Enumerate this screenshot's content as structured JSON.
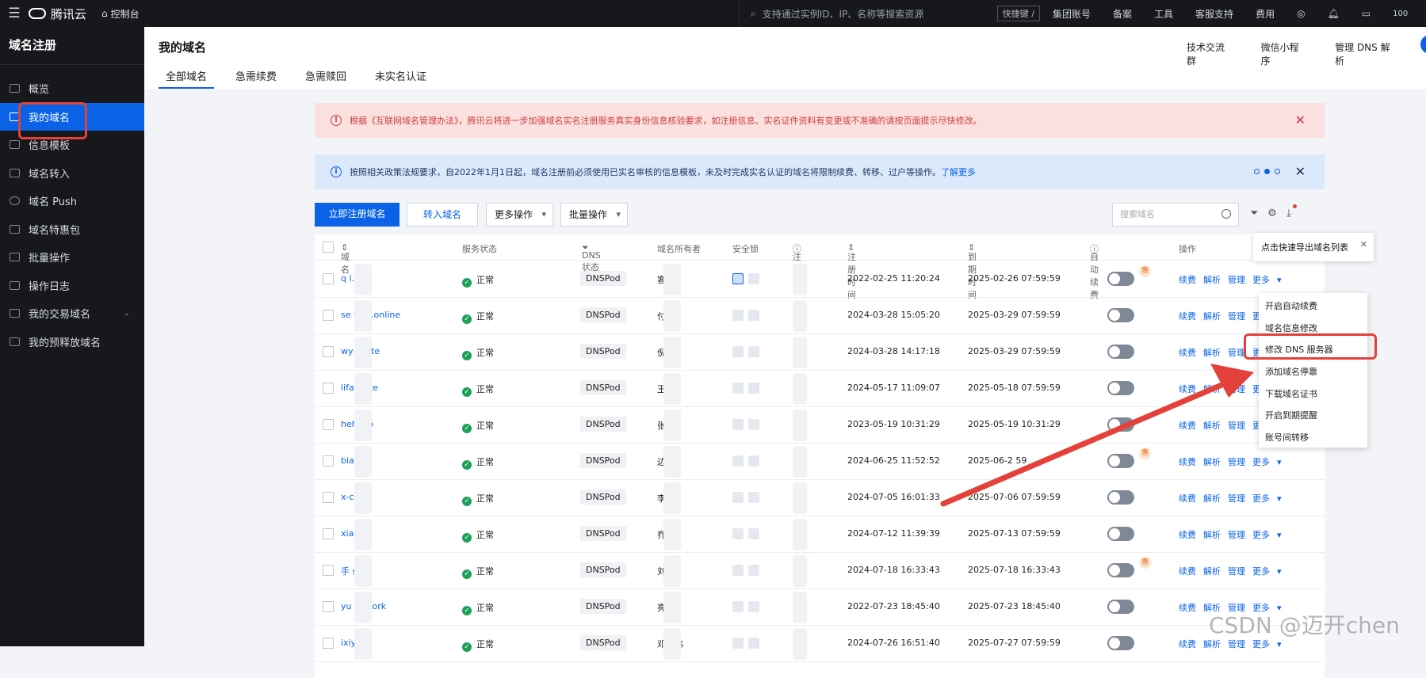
{
  "topbar": {
    "brand": "腾讯云",
    "console": "控制台",
    "search_placeholder": "支持通过实例ID、IP、名称等搜索资源",
    "shortcut": "快捷键 /",
    "links": [
      "集团账号",
      "备案",
      "工具",
      "客服支持",
      "费用"
    ],
    "corner_text": "100"
  },
  "sidebar": {
    "title": "域名注册",
    "items": [
      {
        "label": "概览",
        "icon": "overview-icon"
      },
      {
        "label": "我的域名",
        "icon": "domain-icon",
        "active": true
      },
      {
        "label": "信息模板",
        "icon": "template-icon"
      },
      {
        "label": "域名转入",
        "icon": "transfer-in-icon"
      },
      {
        "label": "域名 Push",
        "icon": "push-icon"
      },
      {
        "label": "域名特惠包",
        "icon": "package-icon"
      },
      {
        "label": "批量操作",
        "icon": "batch-icon"
      },
      {
        "label": "操作日志",
        "icon": "log-icon"
      },
      {
        "label": "我的交易域名",
        "icon": "trade-icon",
        "expandable": true
      },
      {
        "label": "我的预释放域名",
        "icon": "release-icon"
      }
    ]
  },
  "header": {
    "title": "我的域名",
    "links": [
      "技术交流群",
      "微信小程序",
      "管理 DNS 解析"
    ],
    "tabs": [
      "全部域名",
      "急需续费",
      "急需赎回",
      "未实名认证"
    ],
    "active_tab": "全部域名"
  },
  "alerts": {
    "red": "根据《互联网域名管理办法》，腾讯云将进一步加强域名实名注册服务真实身份信息核验要求，如注册信息、实名证件资料有变更或不准确的请按页面提示尽快修改。",
    "blue": "按照相关政策法规要求，自2022年1月1日起，域名注册前必须使用已实名审核的信息模板，未及时完成实名认证的域名将限制续费、转移、过户等操作。",
    "blue_link": "了解更多"
  },
  "toolbar": {
    "register": "立即注册域名",
    "transfer": "转入域名",
    "more_ops": "更多操作",
    "batch_ops": "批量操作",
    "search_placeholder": "搜索域名"
  },
  "table": {
    "columns": [
      "域名",
      "服务状态",
      "DNS状态",
      "域名所有者",
      "安全锁",
      "注册商",
      "注册时间",
      "到期时间",
      "自动续费",
      "操作"
    ],
    "rows": [
      {
        "domain": "q     l.xyz",
        "status": "正常",
        "dns": "DNSPod",
        "owner": "     客",
        "reg": "2022-02-25 11:20:24",
        "exp": "2025-02-26 07:59:59",
        "flag": true
      },
      {
        "domain": "se     vles.online",
        "status": "正常",
        "dns": "DNSPod",
        "owner": "付    ",
        "reg": "2024-03-28 15:05:20",
        "exp": "2025-03-29 07:59:59",
        "flag": false
      },
      {
        "domain": "wy-      l.site",
        "status": "正常",
        "dns": "DNSPod",
        "owner": "倪    ",
        "reg": "2024-03-28 14:17:18",
        "exp": "2025-03-29 07:59:59",
        "flag": false
      },
      {
        "domain": "lifan     site",
        "status": "正常",
        "dns": "DNSPod",
        "owner": "王    ",
        "reg": "2024-05-17 11:09:07",
        "exp": "2025-05-18 07:59:59",
        "flag": false
      },
      {
        "domain": "hehel      b",
        "status": "正常",
        "dns": "DNSPod",
        "owner": "张    ",
        "reg": "2023-05-19 10:31:29",
        "exp": "2025-05-19 10:31:29",
        "flag": false
      },
      {
        "domain": "bianlf.",
        "status": "正常",
        "dns": "DNSPod",
        "owner": "边    ",
        "reg": "2024-06-25 11:52:52",
        "exp": "2025-06-2    59",
        "flag": true
      },
      {
        "domain": "x-cat.t",
        "status": "正常",
        "dns": "DNSPod",
        "owner": "李    ",
        "reg": "2024-07-05 16:01:33",
        "exp": "2025-07-06 07:59:59",
        "flag": false
      },
      {
        "domain": "xiaoy     e",
        "status": "正常",
        "dns": "DNSPod",
        "owner": "乔    ",
        "reg": "2024-07-12 11:39:39",
        "exp": "2025-07-13 07:59:59",
        "flag": false
      },
      {
        "domain": "手     s.cn",
        "status": "正常",
        "dns": "DNSPod",
        "owner": "刘    ",
        "reg": "2024-07-18 16:33:43",
        "exp": "2025-07-18 16:33:43",
        "flag": true
      },
      {
        "domain": "yu     st.work",
        "status": "正常",
        "dns": "DNSPod",
        "owner": "     亮",
        "reg": "2022-07-23 18:45:40",
        "exp": "2025-07-23 18:45:40",
        "flag": false
      },
      {
        "domain": "ixiy.fun",
        "status": "正常",
        "dns": "DNSPod",
        "owner": "邓学伟",
        "reg": "2024-07-26 16:51:40",
        "exp": "2025-07-27 07:59:59",
        "flag": false
      }
    ],
    "actions": [
      "续费",
      "解析",
      "管理",
      "更多"
    ],
    "flag_text": "惠"
  },
  "popover": {
    "text": "点击快速导出域名列表"
  },
  "more_menu": [
    "开启自动续费",
    "域名信息修改",
    "修改 DNS 服务器",
    "添加域名停靠",
    "下载域名证书",
    "开启到期提醒",
    "账号间转移"
  ],
  "watermark": "CSDN @迈开chen",
  "colors": {
    "accent": "#0a63e6",
    "highlight": "#e3413a",
    "sidebar_bg": "#16181c"
  }
}
